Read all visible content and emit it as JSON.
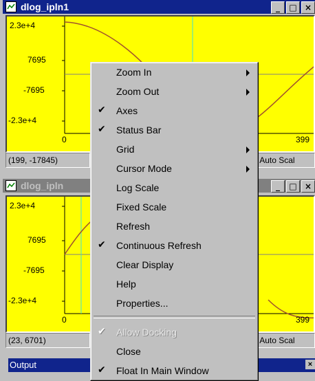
{
  "window1": {
    "title": "dlog_ipln1",
    "y_ticks": [
      "2.3e+4",
      "7695",
      "-7695",
      "-2.3e+4"
    ],
    "x_ticks": [
      "0",
      "399"
    ],
    "status_coords": "(199, -17845)",
    "status_right": "Auto Scal",
    "buttons": [
      "_",
      "□",
      "×"
    ]
  },
  "window2": {
    "title": "dlog_ipln",
    "y_ticks": [
      "2.3e+4",
      "7695",
      "-7695",
      "-2.3e+4"
    ],
    "x_ticks": [
      "0",
      "399"
    ],
    "status_coords": "(23, 6701)",
    "status_right": "Auto Scal",
    "buttons": [
      "_",
      "□",
      "×"
    ]
  },
  "output_bar": {
    "title": "Output",
    "close": "×"
  },
  "colors": {
    "plot_bg": "#ffff00",
    "curve": "#a0522d",
    "cursor": "#40e0d0",
    "title_active": "#10248c"
  },
  "context_menu": {
    "items": [
      {
        "label": "Zoom In",
        "checked": false,
        "submenu": true,
        "disabled": false
      },
      {
        "label": "Zoom Out",
        "checked": false,
        "submenu": true,
        "disabled": false
      },
      {
        "label": "Axes",
        "checked": true,
        "submenu": false,
        "disabled": false
      },
      {
        "label": "Status Bar",
        "checked": true,
        "submenu": false,
        "disabled": false
      },
      {
        "label": "Grid",
        "checked": false,
        "submenu": true,
        "disabled": false
      },
      {
        "label": "Cursor Mode",
        "checked": false,
        "submenu": true,
        "disabled": false
      },
      {
        "label": "Log Scale",
        "checked": false,
        "submenu": false,
        "disabled": false
      },
      {
        "label": "Fixed Scale",
        "checked": false,
        "submenu": false,
        "disabled": false
      },
      {
        "label": "Refresh",
        "checked": false,
        "submenu": false,
        "disabled": false
      },
      {
        "label": "Continuous Refresh",
        "checked": true,
        "submenu": false,
        "disabled": false
      },
      {
        "label": "Clear Display",
        "checked": false,
        "submenu": false,
        "disabled": false
      },
      {
        "label": "Help",
        "checked": false,
        "submenu": false,
        "disabled": false
      },
      {
        "label": "Properties...",
        "checked": false,
        "submenu": false,
        "disabled": false
      },
      {
        "label": "Allow Docking",
        "checked": true,
        "submenu": false,
        "disabled": true
      },
      {
        "label": "Close",
        "checked": false,
        "submenu": false,
        "disabled": false
      },
      {
        "label": "Float In Main Window",
        "checked": true,
        "submenu": false,
        "disabled": false
      }
    ],
    "check_glyph": "✔"
  }
}
